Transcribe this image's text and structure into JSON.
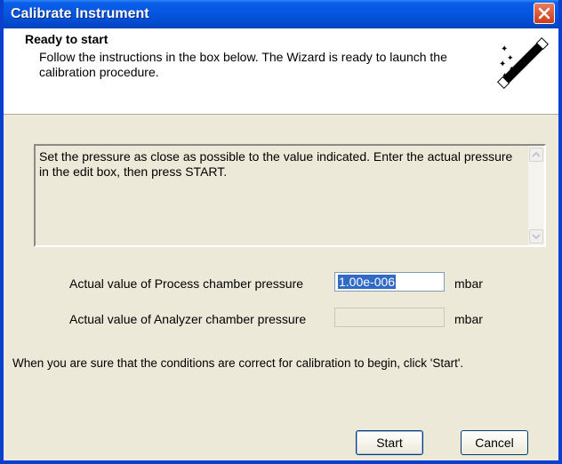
{
  "window": {
    "title": "Calibrate Instrument"
  },
  "header": {
    "title": "Ready to start",
    "subtitle": "Follow the instructions in the box below.  The Wizard is ready to launch the calibration procedure.",
    "icon": "magic-wand-icon"
  },
  "instructions": {
    "text": "Set the pressure as close as possible to the value indicated.  Enter the actual pressure in the edit box, then press START."
  },
  "fields": {
    "process": {
      "label": "Actual value of Process chamber pressure",
      "value": "1.00e-006",
      "unit": "mbar"
    },
    "analyzer": {
      "label": "Actual value of Analyzer chamber pressure",
      "value": "",
      "unit": "mbar"
    }
  },
  "hint": "When you are sure that the conditions are correct for calibration to begin, click 'Start'.",
  "buttons": {
    "start": "Start",
    "cancel": "Cancel"
  },
  "colors": {
    "titlebar": "#0555e0",
    "close": "#cf3c17",
    "dialog_bg": "#ece9d8",
    "selection": "#316ac5"
  }
}
